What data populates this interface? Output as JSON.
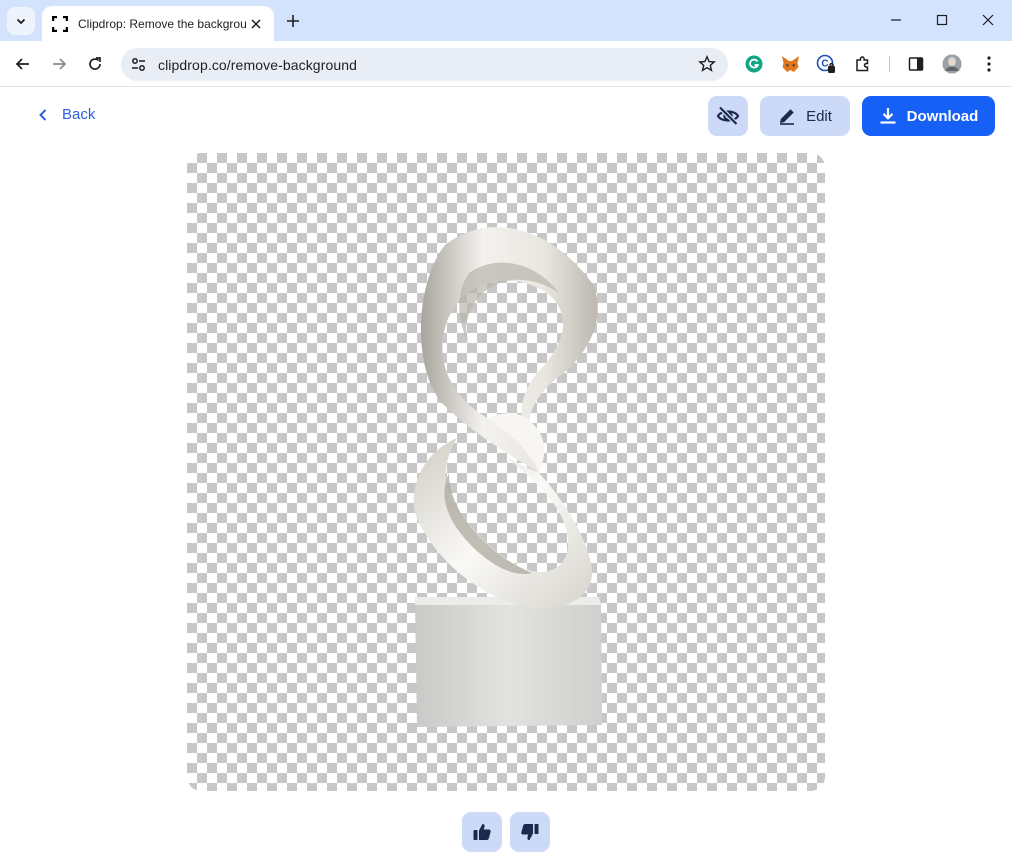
{
  "browser": {
    "tab_title": "Clipdrop: Remove the background",
    "url": "clipdrop.co/remove-background",
    "icons": [
      "tab-search-icon",
      "clipdrop-logo-icon",
      "close-icon",
      "plus-icon",
      "minimize-icon",
      "maximize-icon",
      "close-window-icon",
      "back-arrow-icon",
      "forward-arrow-icon",
      "reload-icon",
      "site-settings-icon",
      "bookmark-star-icon",
      "grammarly-icon",
      "metamask-icon",
      "extension-icon",
      "puzzle-icon",
      "side-panel-icon",
      "profile-avatar",
      "more-menu-icon"
    ]
  },
  "page": {
    "back_label": "Back",
    "edit_label": "Edit",
    "download_label": "Download",
    "image_alt": "White infinity sculpture on pedestal with transparent background",
    "colors": {
      "primary": "#1660f5",
      "secondary_bg": "#ccdaf8",
      "link": "#2f5fe0",
      "checker": "#c7c7c7"
    }
  }
}
